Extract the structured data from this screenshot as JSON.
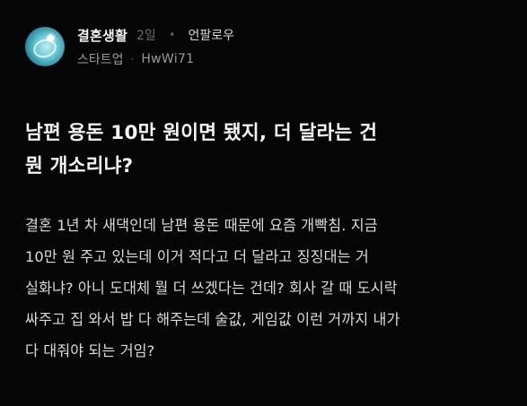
{
  "post": {
    "channel": "결혼생활",
    "time": "2일",
    "separator": "•",
    "follow_label": "언팔로우",
    "company": "스타트업",
    "meta_separator": "·",
    "author": "HwWi71",
    "avatar_icon": "wedding-ring-icon",
    "title_lines": [
      "남편 용돈 10만 원이면 됐지, 더 달라는 건",
      "뭔 개소리냐?"
    ],
    "body_lines": [
      "결혼 1년 차 새댁인데 남편 용돈 때문에 요즘 개빡침. 지금",
      "10만 원 주고 있는데 이거 적다고 더 달라고 징징대는 거",
      "실화냐? 아니 도대체 뭘 더 쓰겠다는 건데? 회사 갈 때 도시락",
      "싸주고 집 와서 밥 다 해주는데 술값, 게임값 이런 거까지 내가",
      "다 대줘야 되는 거임?"
    ]
  },
  "colors": {
    "background": "#050505",
    "title": "#f4f4f4",
    "body": "#dcdcdc",
    "meta": "#9a9a9a",
    "time": "#6a6a6a"
  }
}
